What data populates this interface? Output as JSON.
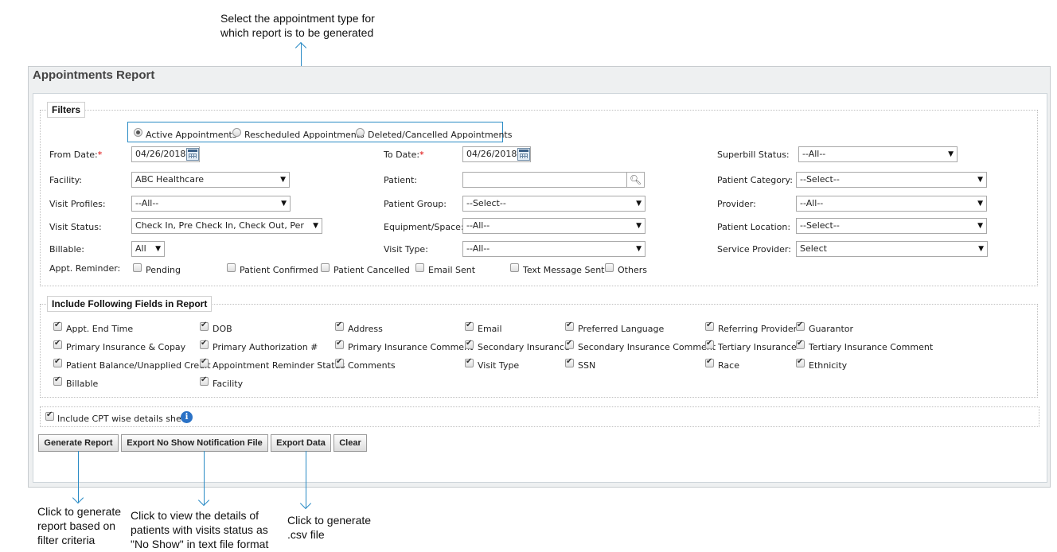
{
  "callouts": {
    "top": [
      "Select the appointment type for",
      "which report is to be generated"
    ],
    "generate": [
      "Click to generate",
      "report based on",
      "filter criteria"
    ],
    "export_no_show": [
      "Click to view the details of",
      "patients with visits status as",
      "\"No Show\" in text file format"
    ],
    "export_data": [
      "Click to generate",
      ".csv file"
    ]
  },
  "report": {
    "title": "Appointments Report"
  },
  "filters": {
    "legend": "Filters",
    "appointment_types": [
      {
        "label": "Active Appointments",
        "selected": true
      },
      {
        "label": "Rescheduled Appointments",
        "selected": false
      },
      {
        "label": "Deleted/Cancelled Appointments",
        "selected": false
      }
    ],
    "from_date": {
      "label": "From Date:",
      "required": "*",
      "value": "04/26/2018"
    },
    "to_date": {
      "label": "To Date:",
      "required": "*",
      "value": "04/26/2018"
    },
    "superbill_status": {
      "label": "Superbill Status:",
      "value": "--All--"
    },
    "facility": {
      "label": "Facility:",
      "value": "ABC Healthcare"
    },
    "patient": {
      "label": "Patient:",
      "value": ""
    },
    "patient_category": {
      "label": "Patient Category:",
      "value": "--Select--"
    },
    "visit_profiles": {
      "label": "Visit Profiles:",
      "value": "--All--"
    },
    "patient_group": {
      "label": "Patient Group:",
      "value": "--Select--"
    },
    "provider": {
      "label": "Provider:",
      "value": "--All--"
    },
    "visit_status": {
      "label": "Visit Status:",
      "value": "Check In, Pre Check In, Check Out, Per"
    },
    "equipment_space": {
      "label": "Equipment/Space:",
      "value": "--All--"
    },
    "patient_location": {
      "label": "Patient Location:",
      "value": "--Select--"
    },
    "billable": {
      "label": "Billable:",
      "value": "All"
    },
    "visit_type": {
      "label": "Visit Type:",
      "value": "--All--"
    },
    "service_provider": {
      "label": "Service Provider:",
      "value": "Select"
    },
    "appt_reminder": {
      "label": "Appt. Reminder:",
      "options": [
        "Pending",
        "Patient Confirmed",
        "Patient Cancelled",
        "Email Sent",
        "Text Message Sent",
        "Others"
      ]
    }
  },
  "include_fields": {
    "legend": "Include Following Fields in Report",
    "items": [
      "Appt. End Time",
      "DOB",
      "Address",
      "Email",
      "Preferred Language",
      "Referring Provider",
      "Guarantor",
      "Primary Insurance & Copay",
      "Primary Authorization #",
      "Primary Insurance Comment",
      "Secondary Insurance",
      "Secondary Insurance Comment",
      "Tertiary Insurance",
      "Tertiary Insurance Comment",
      "Patient Balance/Unapplied Credit",
      "Appointment Reminder Status",
      "Comments",
      "Visit Type",
      "SSN",
      "Race",
      "Ethnicity",
      "Billable",
      "Facility"
    ]
  },
  "cpt_sheet": {
    "label": "Include CPT wise details sheet",
    "checked": true,
    "info_icon": "info-icon"
  },
  "buttons": {
    "generate": "Generate Report",
    "export_no_show": "Export No Show Notification File",
    "export_data": "Export Data",
    "clear": "Clear"
  },
  "colors": {
    "annotation": "#2a8bc5",
    "required": "#dd0000",
    "info": "#2b72c6"
  }
}
